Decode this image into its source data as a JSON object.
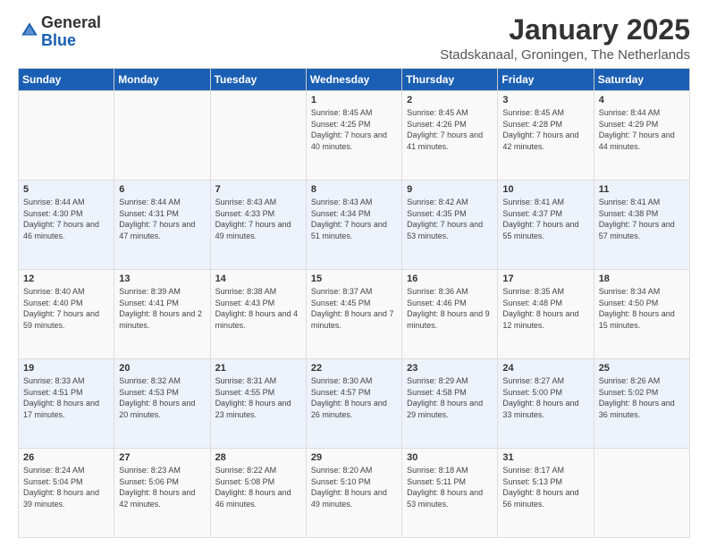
{
  "logo": {
    "general": "General",
    "blue": "Blue"
  },
  "header": {
    "title": "January 2025",
    "subtitle": "Stadskanaal, Groningen, The Netherlands"
  },
  "weekdays": [
    "Sunday",
    "Monday",
    "Tuesday",
    "Wednesday",
    "Thursday",
    "Friday",
    "Saturday"
  ],
  "weeks": [
    [
      {
        "day": "",
        "sunrise": "",
        "sunset": "",
        "daylight": ""
      },
      {
        "day": "",
        "sunrise": "",
        "sunset": "",
        "daylight": ""
      },
      {
        "day": "",
        "sunrise": "",
        "sunset": "",
        "daylight": ""
      },
      {
        "day": "1",
        "sunrise": "Sunrise: 8:45 AM",
        "sunset": "Sunset: 4:25 PM",
        "daylight": "Daylight: 7 hours and 40 minutes."
      },
      {
        "day": "2",
        "sunrise": "Sunrise: 8:45 AM",
        "sunset": "Sunset: 4:26 PM",
        "daylight": "Daylight: 7 hours and 41 minutes."
      },
      {
        "day": "3",
        "sunrise": "Sunrise: 8:45 AM",
        "sunset": "Sunset: 4:28 PM",
        "daylight": "Daylight: 7 hours and 42 minutes."
      },
      {
        "day": "4",
        "sunrise": "Sunrise: 8:44 AM",
        "sunset": "Sunset: 4:29 PM",
        "daylight": "Daylight: 7 hours and 44 minutes."
      }
    ],
    [
      {
        "day": "5",
        "sunrise": "Sunrise: 8:44 AM",
        "sunset": "Sunset: 4:30 PM",
        "daylight": "Daylight: 7 hours and 46 minutes."
      },
      {
        "day": "6",
        "sunrise": "Sunrise: 8:44 AM",
        "sunset": "Sunset: 4:31 PM",
        "daylight": "Daylight: 7 hours and 47 minutes."
      },
      {
        "day": "7",
        "sunrise": "Sunrise: 8:43 AM",
        "sunset": "Sunset: 4:33 PM",
        "daylight": "Daylight: 7 hours and 49 minutes."
      },
      {
        "day": "8",
        "sunrise": "Sunrise: 8:43 AM",
        "sunset": "Sunset: 4:34 PM",
        "daylight": "Daylight: 7 hours and 51 minutes."
      },
      {
        "day": "9",
        "sunrise": "Sunrise: 8:42 AM",
        "sunset": "Sunset: 4:35 PM",
        "daylight": "Daylight: 7 hours and 53 minutes."
      },
      {
        "day": "10",
        "sunrise": "Sunrise: 8:41 AM",
        "sunset": "Sunset: 4:37 PM",
        "daylight": "Daylight: 7 hours and 55 minutes."
      },
      {
        "day": "11",
        "sunrise": "Sunrise: 8:41 AM",
        "sunset": "Sunset: 4:38 PM",
        "daylight": "Daylight: 7 hours and 57 minutes."
      }
    ],
    [
      {
        "day": "12",
        "sunrise": "Sunrise: 8:40 AM",
        "sunset": "Sunset: 4:40 PM",
        "daylight": "Daylight: 7 hours and 59 minutes."
      },
      {
        "day": "13",
        "sunrise": "Sunrise: 8:39 AM",
        "sunset": "Sunset: 4:41 PM",
        "daylight": "Daylight: 8 hours and 2 minutes."
      },
      {
        "day": "14",
        "sunrise": "Sunrise: 8:38 AM",
        "sunset": "Sunset: 4:43 PM",
        "daylight": "Daylight: 8 hours and 4 minutes."
      },
      {
        "day": "15",
        "sunrise": "Sunrise: 8:37 AM",
        "sunset": "Sunset: 4:45 PM",
        "daylight": "Daylight: 8 hours and 7 minutes."
      },
      {
        "day": "16",
        "sunrise": "Sunrise: 8:36 AM",
        "sunset": "Sunset: 4:46 PM",
        "daylight": "Daylight: 8 hours and 9 minutes."
      },
      {
        "day": "17",
        "sunrise": "Sunrise: 8:35 AM",
        "sunset": "Sunset: 4:48 PM",
        "daylight": "Daylight: 8 hours and 12 minutes."
      },
      {
        "day": "18",
        "sunrise": "Sunrise: 8:34 AM",
        "sunset": "Sunset: 4:50 PM",
        "daylight": "Daylight: 8 hours and 15 minutes."
      }
    ],
    [
      {
        "day": "19",
        "sunrise": "Sunrise: 8:33 AM",
        "sunset": "Sunset: 4:51 PM",
        "daylight": "Daylight: 8 hours and 17 minutes."
      },
      {
        "day": "20",
        "sunrise": "Sunrise: 8:32 AM",
        "sunset": "Sunset: 4:53 PM",
        "daylight": "Daylight: 8 hours and 20 minutes."
      },
      {
        "day": "21",
        "sunrise": "Sunrise: 8:31 AM",
        "sunset": "Sunset: 4:55 PM",
        "daylight": "Daylight: 8 hours and 23 minutes."
      },
      {
        "day": "22",
        "sunrise": "Sunrise: 8:30 AM",
        "sunset": "Sunset: 4:57 PM",
        "daylight": "Daylight: 8 hours and 26 minutes."
      },
      {
        "day": "23",
        "sunrise": "Sunrise: 8:29 AM",
        "sunset": "Sunset: 4:58 PM",
        "daylight": "Daylight: 8 hours and 29 minutes."
      },
      {
        "day": "24",
        "sunrise": "Sunrise: 8:27 AM",
        "sunset": "Sunset: 5:00 PM",
        "daylight": "Daylight: 8 hours and 33 minutes."
      },
      {
        "day": "25",
        "sunrise": "Sunrise: 8:26 AM",
        "sunset": "Sunset: 5:02 PM",
        "daylight": "Daylight: 8 hours and 36 minutes."
      }
    ],
    [
      {
        "day": "26",
        "sunrise": "Sunrise: 8:24 AM",
        "sunset": "Sunset: 5:04 PM",
        "daylight": "Daylight: 8 hours and 39 minutes."
      },
      {
        "day": "27",
        "sunrise": "Sunrise: 8:23 AM",
        "sunset": "Sunset: 5:06 PM",
        "daylight": "Daylight: 8 hours and 42 minutes."
      },
      {
        "day": "28",
        "sunrise": "Sunrise: 8:22 AM",
        "sunset": "Sunset: 5:08 PM",
        "daylight": "Daylight: 8 hours and 46 minutes."
      },
      {
        "day": "29",
        "sunrise": "Sunrise: 8:20 AM",
        "sunset": "Sunset: 5:10 PM",
        "daylight": "Daylight: 8 hours and 49 minutes."
      },
      {
        "day": "30",
        "sunrise": "Sunrise: 8:18 AM",
        "sunset": "Sunset: 5:11 PM",
        "daylight": "Daylight: 8 hours and 53 minutes."
      },
      {
        "day": "31",
        "sunrise": "Sunrise: 8:17 AM",
        "sunset": "Sunset: 5:13 PM",
        "daylight": "Daylight: 8 hours and 56 minutes."
      },
      {
        "day": "",
        "sunrise": "",
        "sunset": "",
        "daylight": ""
      }
    ]
  ]
}
